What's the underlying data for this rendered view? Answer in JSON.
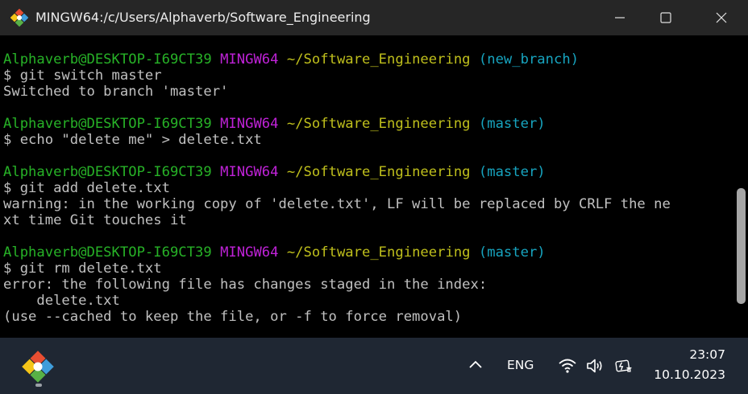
{
  "window": {
    "title": "MINGW64:/c/Users/Alphaverb/Software_Engineering"
  },
  "terminal": {
    "lines": [
      {
        "parts": [
          {
            "text": "Alphaverb@DESKTOP-I69CT39",
            "color": "green"
          },
          {
            "text": " ",
            "color": "plain"
          },
          {
            "text": "MINGW64",
            "color": "magenta"
          },
          {
            "text": " ",
            "color": "plain"
          },
          {
            "text": "~/Software_Engineering",
            "color": "yellow"
          },
          {
            "text": " ",
            "color": "plain"
          },
          {
            "text": "(new_branch)",
            "color": "cyan"
          }
        ]
      },
      {
        "parts": [
          {
            "text": "$ git switch master",
            "color": "plain"
          }
        ]
      },
      {
        "parts": [
          {
            "text": "Switched to branch 'master'",
            "color": "plain"
          }
        ]
      },
      {
        "parts": [
          {
            "text": "",
            "color": "plain"
          }
        ]
      },
      {
        "parts": [
          {
            "text": "Alphaverb@DESKTOP-I69CT39",
            "color": "green"
          },
          {
            "text": " ",
            "color": "plain"
          },
          {
            "text": "MINGW64",
            "color": "magenta"
          },
          {
            "text": " ",
            "color": "plain"
          },
          {
            "text": "~/Software_Engineering",
            "color": "yellow"
          },
          {
            "text": " ",
            "color": "plain"
          },
          {
            "text": "(master)",
            "color": "cyan"
          }
        ]
      },
      {
        "parts": [
          {
            "text": "$ echo \"delete me\" > delete.txt",
            "color": "plain"
          }
        ]
      },
      {
        "parts": [
          {
            "text": "",
            "color": "plain"
          }
        ]
      },
      {
        "parts": [
          {
            "text": "Alphaverb@DESKTOP-I69CT39",
            "color": "green"
          },
          {
            "text": " ",
            "color": "plain"
          },
          {
            "text": "MINGW64",
            "color": "magenta"
          },
          {
            "text": " ",
            "color": "plain"
          },
          {
            "text": "~/Software_Engineering",
            "color": "yellow"
          },
          {
            "text": " ",
            "color": "plain"
          },
          {
            "text": "(master)",
            "color": "cyan"
          }
        ]
      },
      {
        "parts": [
          {
            "text": "$ git add delete.txt",
            "color": "plain"
          }
        ]
      },
      {
        "parts": [
          {
            "text": "warning: in the working copy of 'delete.txt', LF will be replaced by CRLF the ne",
            "color": "plain"
          }
        ]
      },
      {
        "parts": [
          {
            "text": "xt time Git touches it",
            "color": "plain"
          }
        ]
      },
      {
        "parts": [
          {
            "text": "",
            "color": "plain"
          }
        ]
      },
      {
        "parts": [
          {
            "text": "Alphaverb@DESKTOP-I69CT39",
            "color": "green"
          },
          {
            "text": " ",
            "color": "plain"
          },
          {
            "text": "MINGW64",
            "color": "magenta"
          },
          {
            "text": " ",
            "color": "plain"
          },
          {
            "text": "~/Software_Engineering",
            "color": "yellow"
          },
          {
            "text": " ",
            "color": "plain"
          },
          {
            "text": "(master)",
            "color": "cyan"
          }
        ]
      },
      {
        "parts": [
          {
            "text": "$ git rm delete.txt",
            "color": "plain"
          }
        ]
      },
      {
        "parts": [
          {
            "text": "error: the following file has changes staged in the index:",
            "color": "plain"
          }
        ]
      },
      {
        "parts": [
          {
            "text": "    delete.txt",
            "color": "plain"
          }
        ]
      },
      {
        "parts": [
          {
            "text": "(use --cached to keep the file, or -f to force removal)",
            "color": "plain"
          }
        ]
      }
    ]
  },
  "taskbar": {
    "language": "ENG",
    "time": "23:07",
    "date": "10.10.2023",
    "icons": [
      "git-bash-app-icon",
      "chevron-up-icon",
      "wifi-icon",
      "speaker-icon",
      "battery-charging-icon"
    ]
  },
  "colors": {
    "prompt_user": "#27b227",
    "prompt_system": "#bf22d7",
    "prompt_path": "#bfbf1c",
    "prompt_branch": "#17a4bf",
    "terminal_text": "#c0c0c0",
    "taskbar_bg": "#1f2733"
  }
}
